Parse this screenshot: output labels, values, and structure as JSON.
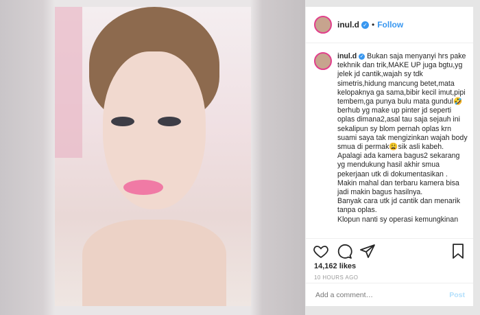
{
  "post": {
    "header": {
      "username": "inul.d",
      "verified_icon": "verified-badge-icon",
      "separator": "•",
      "follow_label": "Follow"
    },
    "comment": {
      "username": "inul.d",
      "text": " Bukan saja menyanyi hrs pake tekhnik dan trik,MAKE UP juga bgtu,yg jelek jd cantik,wajah sy tdk simetris,hidung mancung betet,mata kelopaknya ga sama,bibir kecil imut,pipi tembem,ga punya bulu mata gundul🤣 berhub yg make up pinter jd seperti oplas dimana2,asal tau saja sejauh ini sekalipun sy blom pernah oplas krn suami saya tak mengizinkan wajah body smua di permak😩sik asli kabeh.\nApalagi ada kamera bagus2 sekarang yg mendukung hasil akhir smua pekerjaan utk di dokumentasikan .\nMakin mahal dan terbaru kamera bisa jadi makin bagus hasilnya.\nBanyak cara utk jd cantik dan menarik tanpa oplas.\nKlopun nanti sy operasi kemungkinan"
    },
    "likes": "14,162 likes",
    "timestamp": "10 HOURS AGO",
    "add_comment_placeholder": "Add a comment…",
    "post_label": "Post"
  },
  "colors": {
    "accent": "#3897f0",
    "story_ring": "#e13f8b",
    "post_disabled": "#b2dffc"
  }
}
